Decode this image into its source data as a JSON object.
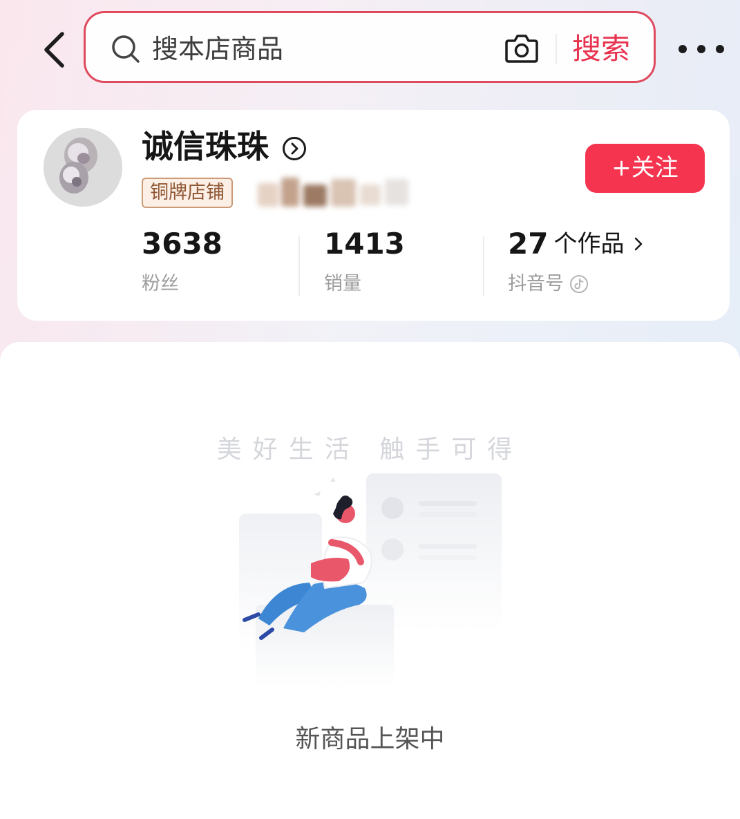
{
  "search": {
    "placeholder": "搜本店商品",
    "button_label": "搜索"
  },
  "shop": {
    "name": "诚信珠珠",
    "tier_badge": "铜牌店铺",
    "follow_label": "+关注",
    "stats": [
      {
        "value": "3638",
        "label": "粉丝"
      },
      {
        "value": "1413",
        "label": "销量"
      },
      {
        "value": "27",
        "unit": "个作品",
        "label": "抖音号"
      }
    ]
  },
  "content": {
    "slogan": "美好生活 触手可得",
    "empty_message": "新商品上架中"
  },
  "colors": {
    "accent": "#f5344f",
    "search_border": "#e04a5f",
    "badge_text": "#8f5634"
  },
  "icons": [
    "back-arrow-icon",
    "search-icon",
    "camera-icon",
    "more-icon",
    "chevron-right-circle-icon",
    "chevron-right-icon",
    "tiktok-icon"
  ]
}
